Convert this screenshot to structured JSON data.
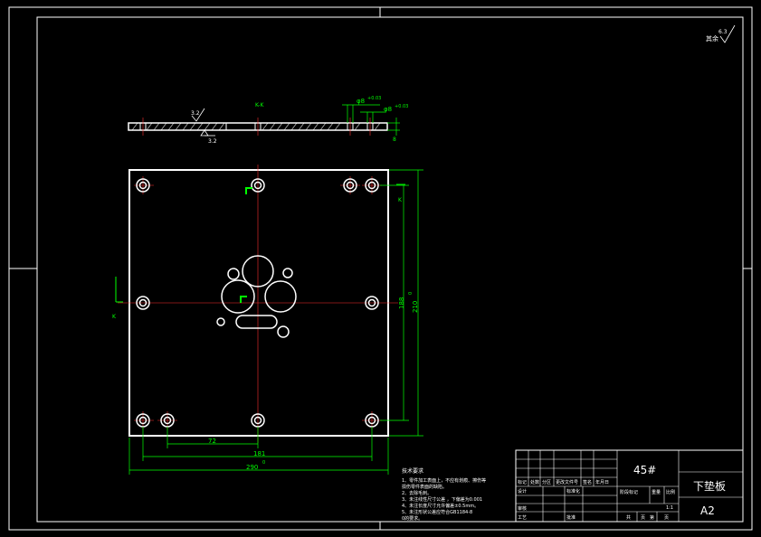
{
  "drawing": {
    "section_label_top": "K-K",
    "section_label_side": "K",
    "roughness_top": "3.2",
    "roughness_bottom": "3.2",
    "dim_hole_1": "φ8",
    "dim_hole_1_tol": "+0.03",
    "dim_hole_2": "φ8",
    "dim_hole_2_tol": "+0.03",
    "dim_thickness": "8",
    "dim_inner_v": "188",
    "dim_outer_v": "210",
    "dim_outer_v_tol": "0",
    "dim_inner_h": "181",
    "dim_small_h": "72",
    "dim_outer_h": "290",
    "dim_outer_h_tol": "0",
    "corner_note": "其余",
    "corner_roughness": "6.3"
  },
  "tech_notes": {
    "title": "技术要求",
    "lines": [
      "1、零件加工表面上，不应有划痕、擦伤等",
      "   损伤零件表面的缺陷。",
      "2、去除毛刺。",
      "3、未注线性尺寸公差 ，下偏差为0.001",
      "4、未注长度尺寸允许偏差±0.5mm。",
      "5、未注形状公差应符合GB1184-8",
      "   0的要求。"
    ]
  },
  "title_block": {
    "material": "45#",
    "part_name": "下垫板",
    "sheet_size": "A2",
    "labels": [
      "标记",
      "处数",
      "分区",
      "更改文件号",
      "签名",
      "年月日",
      "设计",
      "标准化",
      "审核",
      "工艺",
      "批准",
      "阶段标记",
      "重量",
      "比例",
      "共",
      "页",
      "第",
      "页"
    ],
    "scale": "1:1"
  }
}
